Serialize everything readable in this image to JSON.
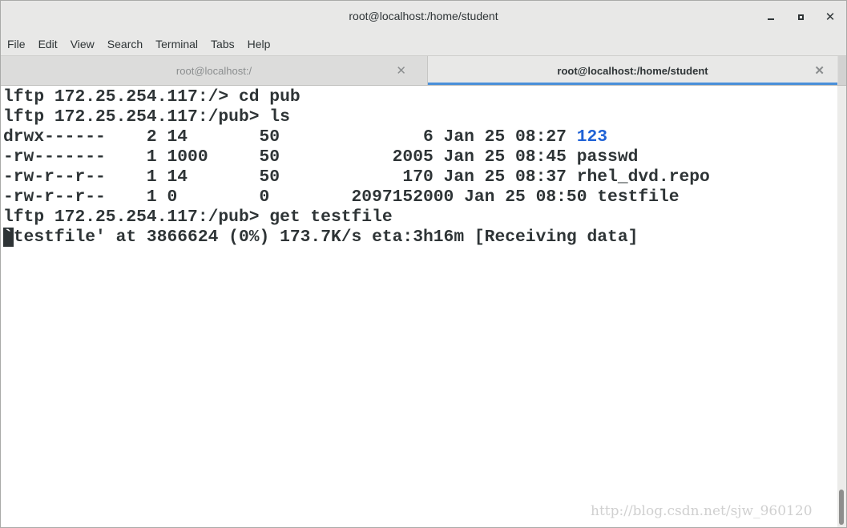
{
  "window": {
    "title": "root@localhost:/home/student",
    "minimize_icon": "minimize-icon",
    "maximize_icon": "maximize-icon",
    "close_glyph": "✕"
  },
  "menu": [
    "File",
    "Edit",
    "View",
    "Search",
    "Terminal",
    "Tabs",
    "Help"
  ],
  "tabs": [
    {
      "label": "root@localhost:/",
      "close": "✕",
      "active": false
    },
    {
      "label": "root@localhost:/home/student",
      "close": "✕",
      "active": true
    }
  ],
  "terminal": {
    "lines": [
      "lftp 172.25.254.117:/> cd pub",
      "lftp 172.25.254.117:/pub> ls",
      {
        "prefix": "drwx------    2 14       50              6 Jan 25 08:27 ",
        "dir_name": "123"
      },
      "-rw-------    1 1000     50           2005 Jan 25 08:45 passwd",
      "-rw-r--r--    1 14       50            170 Jan 25 08:37 rhel_dvd.repo",
      "-rw-r--r--    1 0        0        2097152000 Jan 25 08:50 testfile",
      "lftp 172.25.254.117:/pub> get testfile",
      {
        "cursor_char": "`",
        "rest": "testfile' at 3866624 (0%) 173.7K/s eta:3h16m [Receiving data]"
      }
    ],
    "colors": {
      "text": "#2e3436",
      "directory": "#1f62d6",
      "background": "#ffffff"
    }
  },
  "watermark": "http://blog.csdn.net/sjw_960120",
  "colors": {
    "accent": "#4a90d9",
    "chrome": "#e8e8e7"
  }
}
